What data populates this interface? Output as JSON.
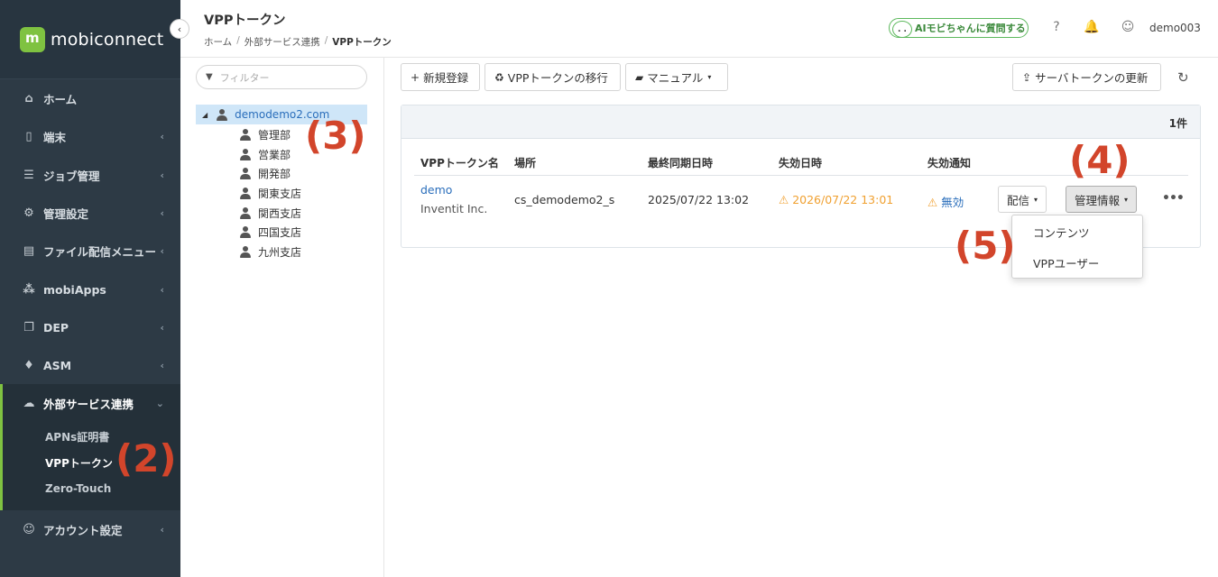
{
  "sidebar": {
    "logo_text": "mobiconnect",
    "collapse_icon": "‹",
    "items": [
      {
        "label": "ホーム",
        "icon": "⌂",
        "chevron": ""
      },
      {
        "label": "端末",
        "icon": "▯",
        "chevron": "‹"
      },
      {
        "label": "ジョブ管理",
        "icon": "☰",
        "chevron": "‹"
      },
      {
        "label": "管理設定",
        "icon": "⚙",
        "chevron": "‹"
      },
      {
        "label": "ファイル配信メニュー",
        "icon": "▤",
        "chevron": "‹"
      },
      {
        "label": "mobiApps",
        "icon": "⁂",
        "chevron": "‹"
      },
      {
        "label": "DEP",
        "icon": "❐",
        "chevron": "‹"
      },
      {
        "label": "ASM",
        "icon": "♦",
        "chevron": "‹"
      },
      {
        "label": "外部サービス連携",
        "icon": "☁",
        "chevron": "⌄"
      },
      {
        "label": "アカウント設定",
        "icon": "☺",
        "chevron": "‹"
      }
    ],
    "subitems": [
      "APNs証明書",
      "VPPトークン",
      "Zero-Touch"
    ],
    "active_subitem": "VPPトークン"
  },
  "header": {
    "title": "VPPトークン",
    "breadcrumb": [
      "ホーム",
      "外部サービス連携",
      "VPPトークン"
    ],
    "breadcrumb_sep": "/",
    "ai_button": "AIモビちゃんに質問する",
    "ai_face": ". .",
    "help_icon": "?",
    "bell_icon": "🔔",
    "user_icon": "☺",
    "user_name": "demo003"
  },
  "tree": {
    "filter_placeholder": "フィルター",
    "filter_icon": "▼",
    "root_toggle": "◢",
    "root": "demodemo2.com",
    "children": [
      "管理部",
      "営業部",
      "開発部",
      "関東支店",
      "関西支店",
      "四国支店",
      "九州支店"
    ]
  },
  "toolbar": {
    "new_icon": "+",
    "new": "新規登録",
    "migrate_icon": "♻",
    "migrate": "VPPトークンの移行",
    "manual_icon": "▰",
    "manual": "マニュアル",
    "server_icon": "⇪",
    "server_token": "サーバトークンの更新",
    "refresh_icon": "↻",
    "caret": "▾"
  },
  "table": {
    "count": "1件",
    "headers": [
      "VPPトークン名",
      "場所",
      "最終同期日時",
      "失効日時",
      "失効通知"
    ],
    "row": {
      "name": "demo",
      "org": "Inventit Inc.",
      "location": "cs_demodemo2_s",
      "last_sync": "2025/07/22 13:02",
      "expiry_icon": "⚠",
      "expiry": "2026/07/22 13:01",
      "notify_icon": "⚠",
      "notify": "無効"
    },
    "actions": {
      "deliver": "配信",
      "manage": "管理情報",
      "more": "•••"
    }
  },
  "dropdown": {
    "items": [
      "コンテンツ",
      "VPPユーザー"
    ]
  },
  "annotations": {
    "a2": "(2)",
    "a3": "(3)",
    "a4": "(4)",
    "a5": "(5)"
  },
  "colors": {
    "sidebar_bg": "#2d3a45",
    "accent_green": "#7fc241",
    "link_blue": "#2a6ebb",
    "warning_orange": "#f0a030",
    "annotation_red": "#d2452b"
  }
}
